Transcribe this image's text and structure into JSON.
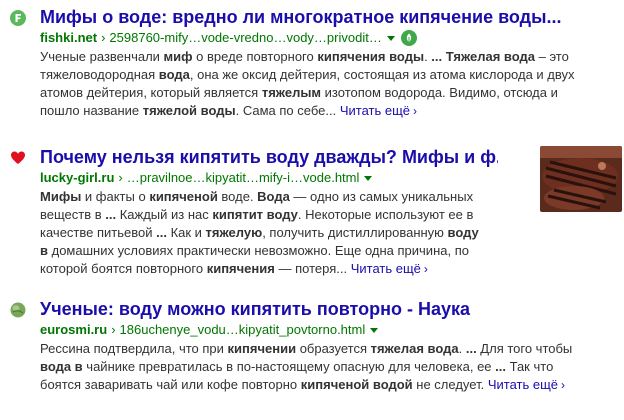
{
  "results": [
    {
      "favicon": "fishki-f-icon",
      "title": [
        {
          "t": "Мифы",
          "b": true
        },
        {
          "t": " о ",
          "b": false
        },
        {
          "t": "воде",
          "b": true
        },
        {
          "t": ": вредно ли многократное ",
          "b": false
        },
        {
          "t": "кипячение воды",
          "b": true
        },
        {
          "t": "...",
          "b": false
        }
      ],
      "domain": "fishki.net",
      "path": "2598760-mify…vode-vredno…vody…privodit…",
      "badge": "ecology-badge-icon",
      "snippet": [
        {
          "t": "Ученые развенчали ",
          "b": false
        },
        {
          "t": "миф",
          "b": true
        },
        {
          "t": " о вреде повторного ",
          "b": false
        },
        {
          "t": "кипячения воды",
          "b": true
        },
        {
          "t": ". ",
          "b": false
        },
        {
          "t": "... Тяжелая вода",
          "b": true
        },
        {
          "t": " – это тяжеловодородная ",
          "b": false
        },
        {
          "t": "вода",
          "b": true
        },
        {
          "t": ", она же оксид дейтерия, состоящая из атома кислорода и двух атомов дейтерия, который является ",
          "b": false
        },
        {
          "t": "тяжелым",
          "b": true
        },
        {
          "t": " изотопом водорода. Видимо, отсюда и пошло название ",
          "b": false
        },
        {
          "t": "тяжелой воды",
          "b": true
        },
        {
          "t": ". Сама по себе...",
          "b": false
        }
      ],
      "more": "Читать ещё"
    },
    {
      "favicon": "heart-icon",
      "title": [
        {
          "t": "Почему нельзя ",
          "b": false
        },
        {
          "t": "кипятить воду",
          "b": true
        },
        {
          "t": " дважды? ",
          "b": false
        },
        {
          "t": "Мифы",
          "b": true
        },
        {
          "t": " и ф...",
          "b": false
        }
      ],
      "domain": "lucky-girl.ru",
      "path": "…pravilnoe…kipyatit…mify-i…vode.html",
      "snippet": [
        {
          "t": "Мифы",
          "b": true
        },
        {
          "t": " и факты о ",
          "b": false
        },
        {
          "t": "кипяченой",
          "b": true
        },
        {
          "t": " воде. ",
          "b": false
        },
        {
          "t": "Вода",
          "b": true
        },
        {
          "t": " — одно из самых уникальных веществ в ",
          "b": false
        },
        {
          "t": "...",
          "b": true
        },
        {
          "t": " Каждый из нас ",
          "b": false
        },
        {
          "t": "кипятит воду",
          "b": true
        },
        {
          "t": ". Некоторые используют ее в качестве питьевой ",
          "b": false
        },
        {
          "t": "...",
          "b": true
        },
        {
          "t": " Как и ",
          "b": false
        },
        {
          "t": "тяжелую",
          "b": true
        },
        {
          "t": ", получить дистиллированную ",
          "b": false
        },
        {
          "t": "воду в",
          "b": true
        },
        {
          "t": " домашних условиях практически невозможно. Еще одна причина, по которой боятся повторного ",
          "b": false
        },
        {
          "t": "кипячения",
          "b": true
        },
        {
          "t": " — потеря...",
          "b": false
        }
      ],
      "more": "Читать ещё",
      "thumb": "grilled-meat-thumbnail"
    },
    {
      "favicon": "eurosmi-globe-icon",
      "title": [
        {
          "t": "Ученые: ",
          "b": false
        },
        {
          "t": "воду",
          "b": true
        },
        {
          "t": " можно ",
          "b": false
        },
        {
          "t": "кипятить",
          "b": true
        },
        {
          "t": " повторно - Наука",
          "b": false
        }
      ],
      "domain": "eurosmi.ru",
      "path": "186uchenye_vodu…kipyatit_povtorno.html",
      "snippet": [
        {
          "t": "Рессина подтвердила, что при ",
          "b": false
        },
        {
          "t": "кипячении",
          "b": true
        },
        {
          "t": " образуется ",
          "b": false
        },
        {
          "t": "тяжелая вода",
          "b": true
        },
        {
          "t": ". ",
          "b": false
        },
        {
          "t": "...",
          "b": true
        },
        {
          "t": " Для того чтобы ",
          "b": false
        },
        {
          "t": "вода в",
          "b": true
        },
        {
          "t": " чайнике превратилась в по-настоящему опасную для человека, ее ",
          "b": false
        },
        {
          "t": "...",
          "b": true
        },
        {
          "t": " Так что боятся заваривать чай или кофе повторно ",
          "b": false
        },
        {
          "t": "кипяченой водой",
          "b": true
        },
        {
          "t": " не следует.",
          "b": false
        }
      ],
      "more": "Читать ещё"
    }
  ],
  "colors": {
    "title_link": "#1a0dab",
    "url_green": "#007700",
    "snippet_text": "#333333",
    "fishki_green": "#5cb85c",
    "heart_red": "#e0101e"
  }
}
